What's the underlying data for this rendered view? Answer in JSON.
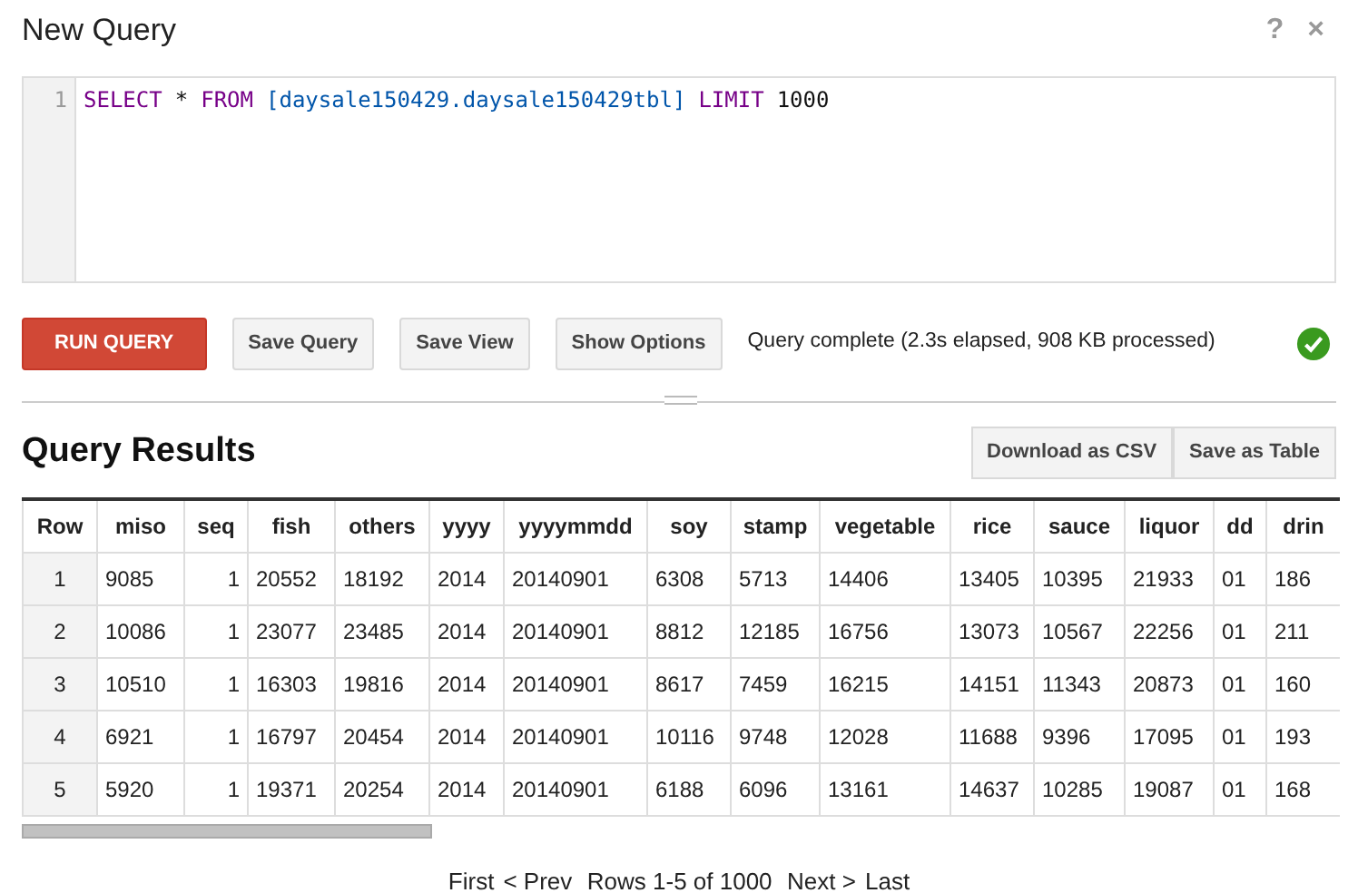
{
  "window": {
    "title": "New Query",
    "help": "?",
    "close": "×"
  },
  "editor": {
    "line_number": "1",
    "tokens": [
      {
        "text": "SELECT",
        "kind": "keyword"
      },
      {
        "text": "*",
        "kind": "plain"
      },
      {
        "text": "FROM",
        "kind": "keyword"
      },
      {
        "text": "[daysale150429.daysale150429tbl]",
        "kind": "table"
      },
      {
        "text": "LIMIT",
        "kind": "keyword"
      },
      {
        "text": "1000",
        "kind": "plain"
      }
    ]
  },
  "actions": [
    {
      "label": "RUN QUERY",
      "kind": "primary"
    },
    {
      "label": "Save Query",
      "kind": "secondary"
    },
    {
      "label": "Save View",
      "kind": "secondary"
    },
    {
      "label": "Show Options",
      "kind": "secondary"
    }
  ],
  "status": {
    "text": "Query complete (2.3s elapsed, 908 KB processed)",
    "success": true
  },
  "results": {
    "title": "Query Results",
    "buttons": [
      "Download as CSV",
      "Save as Table"
    ]
  },
  "table": {
    "columns": [
      "Row",
      "miso",
      "seq",
      "fish",
      "others",
      "yyyy",
      "yyyymmdd",
      "soy",
      "stamp",
      "vegetable",
      "rice",
      "sauce",
      "liquor",
      "dd",
      "drin"
    ],
    "rows": [
      [
        "1",
        "9085",
        "1",
        "20552",
        "18192",
        "2014",
        "20140901",
        "6308",
        "5713",
        "14406",
        "13405",
        "10395",
        "21933",
        "01",
        "186"
      ],
      [
        "2",
        "10086",
        "1",
        "23077",
        "23485",
        "2014",
        "20140901",
        "8812",
        "12185",
        "16756",
        "13073",
        "10567",
        "22256",
        "01",
        "211"
      ],
      [
        "3",
        "10510",
        "1",
        "16303",
        "19816",
        "2014",
        "20140901",
        "8617",
        "7459",
        "16215",
        "14151",
        "11343",
        "20873",
        "01",
        "160"
      ],
      [
        "4",
        "6921",
        "1",
        "16797",
        "20454",
        "2014",
        "20140901",
        "10116",
        "9748",
        "12028",
        "11688",
        "9396",
        "17095",
        "01",
        "193"
      ],
      [
        "5",
        "5920",
        "1",
        "19371",
        "20254",
        "2014",
        "20140901",
        "6188",
        "6096",
        "13161",
        "14637",
        "10285",
        "19087",
        "01",
        "168"
      ]
    ]
  },
  "pager": {
    "first": "First",
    "prev": "< Prev",
    "info": "Rows 1-5 of 1000",
    "next": "Next >",
    "last": "Last"
  }
}
